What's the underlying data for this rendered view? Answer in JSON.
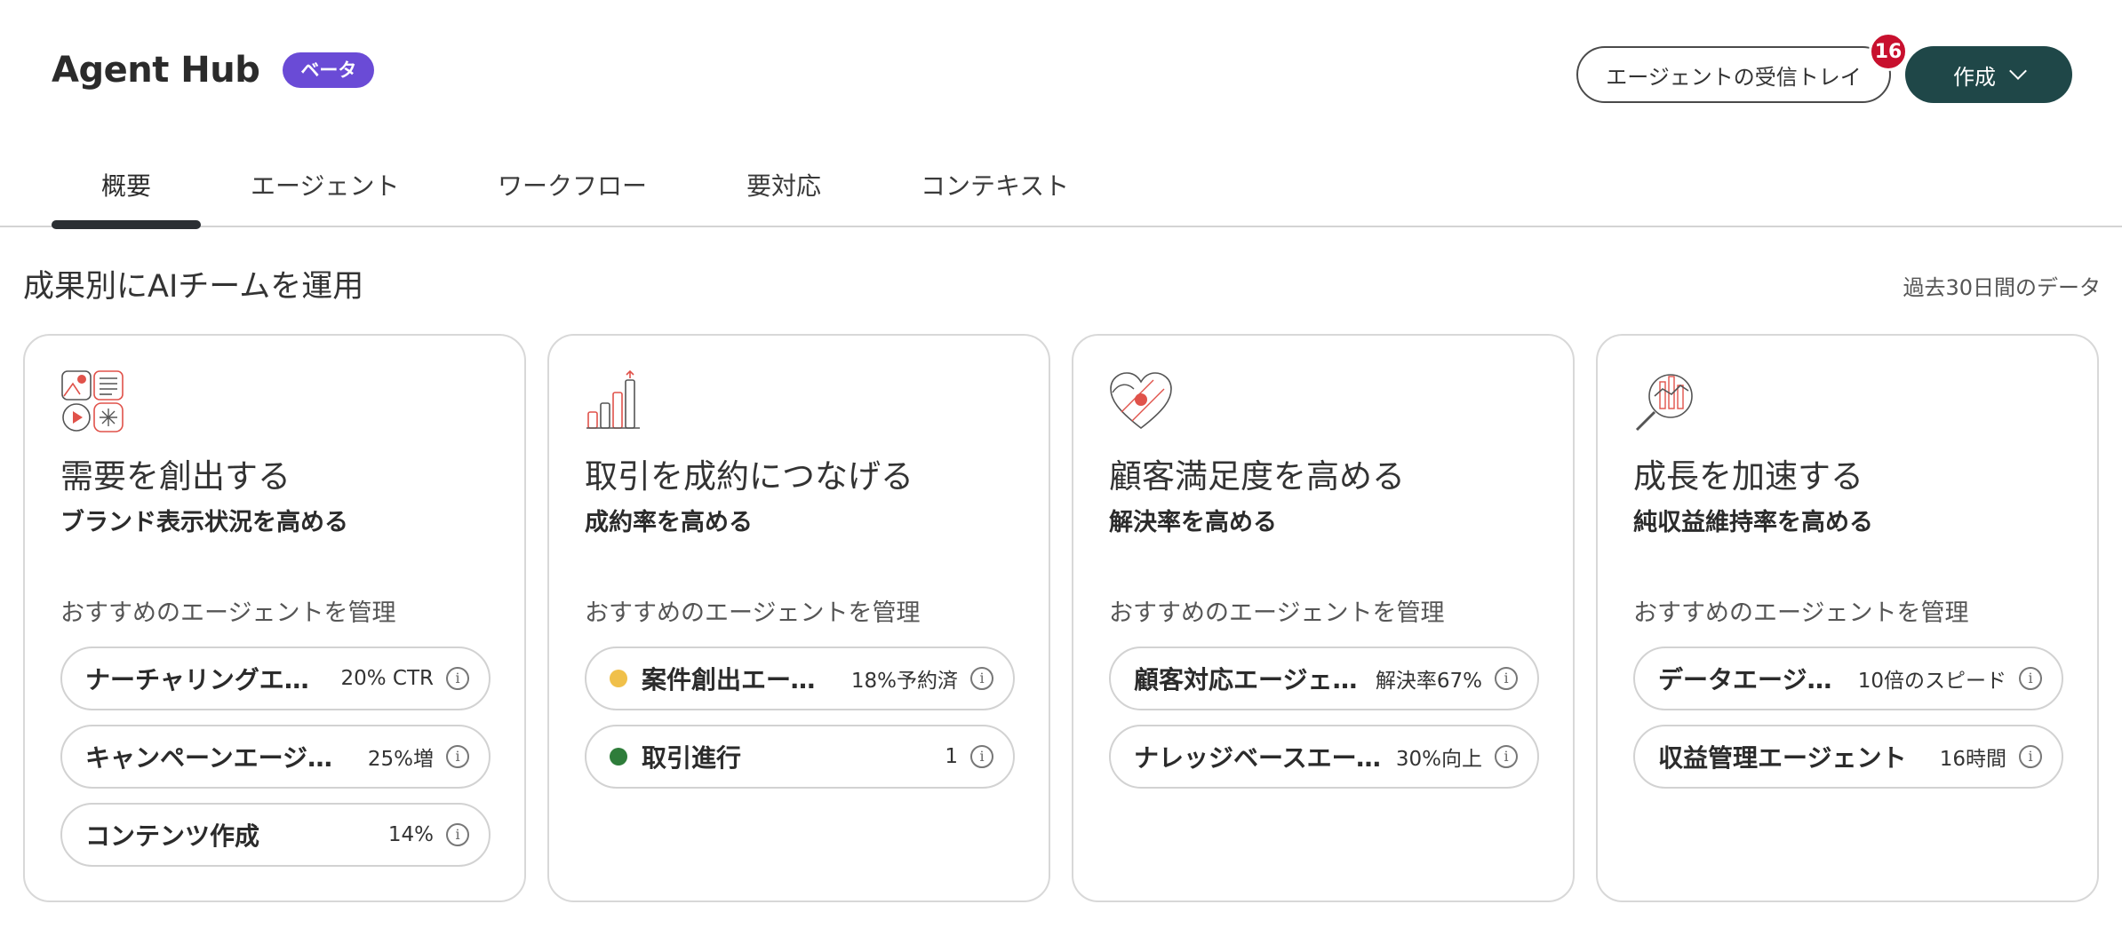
{
  "header": {
    "title": "Agent Hub",
    "beta_label": "ベータ",
    "inbox_label": "エージェントの受信トレイ",
    "inbox_count": "16",
    "create_label": "作成"
  },
  "tabs": [
    {
      "label": "概要",
      "active": true
    },
    {
      "label": "エージェント",
      "active": false
    },
    {
      "label": "ワークフロー",
      "active": false
    },
    {
      "label": "要対応",
      "active": false
    },
    {
      "label": "コンテキスト",
      "active": false
    }
  ],
  "section": {
    "title": "成果別にAIチームを運用",
    "note": "過去30日間のデータ"
  },
  "cards": [
    {
      "icon": "demand-icon",
      "title": "需要を創出する",
      "subtitle": "ブランド表示状況を高める",
      "label": "おすすめのエージェントを管理",
      "agents": [
        {
          "name": "ナーチャリングエージェント",
          "metric": "20% CTR"
        },
        {
          "name": "キャンペーンエージェント",
          "metric": "25%増"
        },
        {
          "name": "コンテンツ作成",
          "metric": "14%"
        }
      ]
    },
    {
      "icon": "bar-growth-icon",
      "title": "取引を成約につなげる",
      "subtitle": "成約率を高める",
      "label": "おすすめのエージェントを管理",
      "agents": [
        {
          "name": "案件創出エージェント",
          "metric": "18%予約済",
          "status_color": "#f0c04a"
        },
        {
          "name": "取引進行",
          "metric": "1",
          "status_color": "#2e7d3a"
        }
      ]
    },
    {
      "icon": "heart-satisfaction-icon",
      "title": "顧客満足度を高める",
      "subtitle": "解決率を高める",
      "label": "おすすめのエージェントを管理",
      "agents": [
        {
          "name": "顧客対応エージェント",
          "metric": "解決率67%"
        },
        {
          "name": "ナレッジベースエージェント",
          "metric": "30%向上"
        }
      ]
    },
    {
      "icon": "magnifier-chart-icon",
      "title": "成長を加速する",
      "subtitle": "純収益維持率を高める",
      "label": "おすすめのエージェントを管理",
      "agents": [
        {
          "name": "データエージェント",
          "metric": "10倍のスピード"
        },
        {
          "name": "収益管理エージェント",
          "metric": "16時間"
        }
      ]
    }
  ],
  "colors": {
    "accent_dark": "#1f4748",
    "beta": "#6a4bd6",
    "badge": "#c8102e",
    "icon_red": "#e0524a"
  }
}
